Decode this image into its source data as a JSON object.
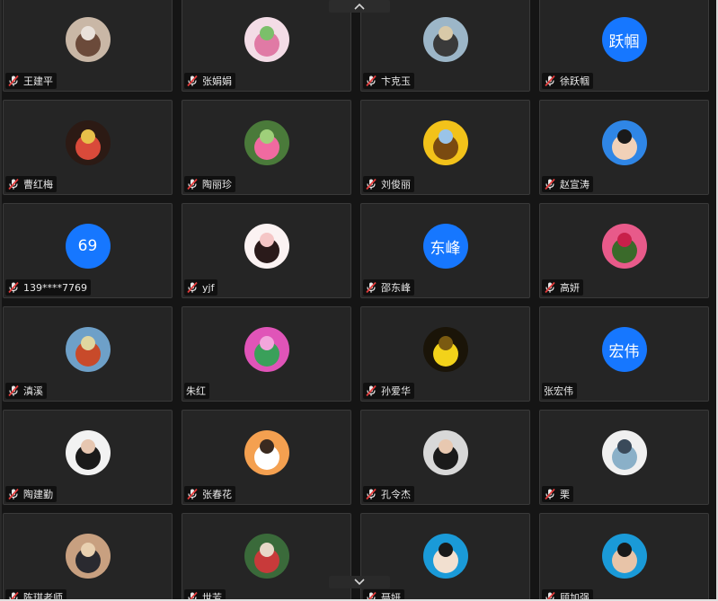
{
  "participants": [
    {
      "name": "王建平",
      "muted": true,
      "avatar": {
        "kind": "photo",
        "label": "",
        "colors": [
          "#c9b7a6",
          "#6b4a3a",
          "#e9e1da"
        ]
      }
    },
    {
      "name": "张娟娟",
      "muted": true,
      "avatar": {
        "kind": "photo",
        "label": "",
        "colors": [
          "#f3dce6",
          "#e07aa5",
          "#7bbf6a"
        ]
      }
    },
    {
      "name": "卞克玉",
      "muted": true,
      "avatar": {
        "kind": "photo",
        "label": "",
        "colors": [
          "#9cb6c8",
          "#3a3a3a",
          "#d8c9a8"
        ]
      }
    },
    {
      "name": "徐跃帼",
      "muted": true,
      "avatar": {
        "kind": "text",
        "label": "跃帼",
        "colors": [
          "#1677ff"
        ]
      }
    },
    {
      "name": "曹红梅",
      "muted": true,
      "avatar": {
        "kind": "photo",
        "label": "",
        "colors": [
          "#2c1a14",
          "#d94a3a",
          "#e8c04a"
        ]
      }
    },
    {
      "name": "陶丽珍",
      "muted": true,
      "avatar": {
        "kind": "photo",
        "label": "",
        "colors": [
          "#4a7a3a",
          "#f06aa0",
          "#9fd07a"
        ]
      }
    },
    {
      "name": "刘俊丽",
      "muted": true,
      "avatar": {
        "kind": "photo",
        "label": "",
        "colors": [
          "#f2c21a",
          "#7a4a10",
          "#9ac4e8"
        ]
      }
    },
    {
      "name": "赵宣涛",
      "muted": true,
      "avatar": {
        "kind": "photo",
        "label": "",
        "colors": [
          "#2f86e6",
          "#f1d1b8",
          "#1a1a1a"
        ]
      }
    },
    {
      "name": "139****7769",
      "muted": true,
      "avatar": {
        "kind": "text",
        "label": "69",
        "colors": [
          "#1677ff"
        ]
      }
    },
    {
      "name": "yjf",
      "muted": true,
      "avatar": {
        "kind": "photo",
        "label": "",
        "colors": [
          "#fbf2f2",
          "#2a1a1a",
          "#f5c6c6"
        ]
      }
    },
    {
      "name": "邵东峰",
      "muted": true,
      "avatar": {
        "kind": "text",
        "label": "东峰",
        "colors": [
          "#1677ff"
        ]
      }
    },
    {
      "name": "高妍",
      "muted": true,
      "avatar": {
        "kind": "photo",
        "label": "",
        "colors": [
          "#e85a8a",
          "#3a6a2a",
          "#c8204a"
        ]
      }
    },
    {
      "name": "滇溪",
      "muted": true,
      "avatar": {
        "kind": "photo",
        "label": "",
        "colors": [
          "#6ea0c8",
          "#c84a2a",
          "#e0d6a0"
        ]
      }
    },
    {
      "name": "朱红",
      "muted": false,
      "avatar": {
        "kind": "photo",
        "label": "",
        "colors": [
          "#e054b8",
          "#3aa05a",
          "#f2a6dc"
        ]
      }
    },
    {
      "name": "孙爱华",
      "muted": true,
      "avatar": {
        "kind": "photo",
        "label": "",
        "colors": [
          "#1a1408",
          "#f2d21a",
          "#7a5a10"
        ]
      }
    },
    {
      "name": "张宏伟",
      "muted": false,
      "avatar": {
        "kind": "text",
        "label": "宏伟",
        "colors": [
          "#1677ff"
        ]
      }
    },
    {
      "name": "陶建勤",
      "muted": true,
      "avatar": {
        "kind": "photo",
        "label": "",
        "colors": [
          "#f2f2f2",
          "#1a1a1a",
          "#e6c6b0"
        ]
      }
    },
    {
      "name": "张春花",
      "muted": true,
      "avatar": {
        "kind": "photo",
        "label": "",
        "colors": [
          "#f4a050",
          "#ffffff",
          "#3a2a20"
        ]
      }
    },
    {
      "name": "孔令杰",
      "muted": true,
      "avatar": {
        "kind": "photo",
        "label": "",
        "colors": [
          "#d8d8d8",
          "#1a1a1a",
          "#e8c8b0"
        ]
      }
    },
    {
      "name": "栗",
      "muted": true,
      "avatar": {
        "kind": "photo",
        "label": "",
        "colors": [
          "#f0f0f0",
          "#8ab0c8",
          "#3a4a5a"
        ]
      }
    },
    {
      "name": "陈琪老师",
      "muted": true,
      "avatar": {
        "kind": "photo",
        "label": "",
        "colors": [
          "#c8a080",
          "#2a2a30",
          "#e8d0b0"
        ]
      }
    },
    {
      "name": "世芳",
      "muted": true,
      "avatar": {
        "kind": "photo",
        "label": "",
        "colors": [
          "#3a6a3a",
          "#c83a3a",
          "#e8d8c8"
        ]
      }
    },
    {
      "name": "聂妍",
      "muted": true,
      "avatar": {
        "kind": "photo",
        "label": "",
        "colors": [
          "#1a9ad8",
          "#f2e0d0",
          "#1a1a1a"
        ]
      }
    },
    {
      "name": "顾加强",
      "muted": true,
      "avatar": {
        "kind": "photo",
        "label": "",
        "colors": [
          "#1a9ad8",
          "#e8c4a8",
          "#1a1a1a"
        ]
      }
    }
  ],
  "nav": {
    "scroll_up_icon": "chevron-up-icon",
    "scroll_down_icon": "chevron-down-icon"
  },
  "colors": {
    "tile_bg": "#252525",
    "tile_border": "#3a3a3a",
    "text_avatar_bg": "#1677ff",
    "muted_mic": "#e23b3b"
  }
}
